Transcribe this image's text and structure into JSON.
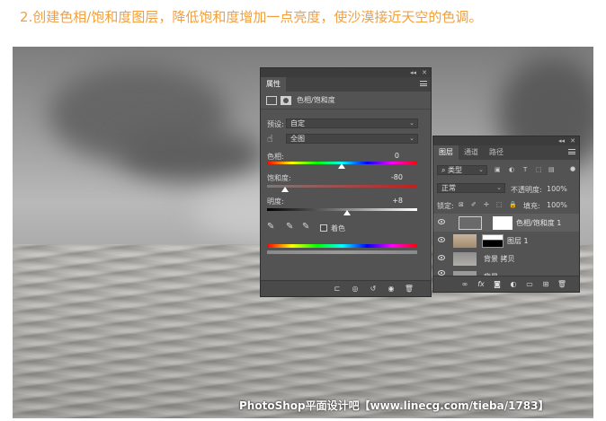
{
  "heading": "2.创建色相/饱和度图层，降低饱和度增加一点亮度，使沙漠接近天空的色调。",
  "watermark": "PhotoShop平面设计吧【www.linecg.com/tieba/1783】",
  "properties": {
    "tab": "属性",
    "adjustment_name": "色相/饱和度",
    "preset_label": "预设:",
    "preset_value": "自定",
    "range_value": "全图",
    "hue_label": "色相:",
    "hue_value": "0",
    "saturation_label": "饱和度:",
    "saturation_value": "-80",
    "lightness_label": "明度:",
    "lightness_value": "+8",
    "colorize_label": "着色"
  },
  "layers": {
    "tabs": [
      "图层",
      "通道",
      "路径"
    ],
    "filter_kind": "类型",
    "blend_mode": "正常",
    "opacity_label": "不透明度:",
    "opacity_value": "100%",
    "lock_label": "锁定:",
    "fill_label": "填充:",
    "fill_value": "100%",
    "items": [
      {
        "name": "色相/饱和度 1"
      },
      {
        "name": "图层 1"
      },
      {
        "name": "背景 拷贝"
      },
      {
        "name": "背景"
      }
    ]
  },
  "colors": {
    "accent_heading": "#f0a040",
    "panel_bg": "#535353"
  }
}
